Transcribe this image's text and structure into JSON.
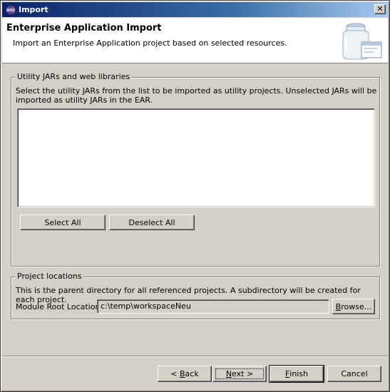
{
  "window": {
    "title": "Import"
  },
  "header": {
    "title": "Enterprise Application Import",
    "description": "Import an Enterprise Application project based on selected resources."
  },
  "utility_group": {
    "legend": "Utility JARs and web libraries",
    "description": "Select the utility JARs from the list to be imported as utility projects. Unselected JARs will be imported as utility JARs in the EAR.",
    "select_all_label": "Select All",
    "deselect_all_label": "Deselect All"
  },
  "project_locations": {
    "legend": "Project locations",
    "description": "This is the parent directory for all referenced projects. A subdirectory will be created for each project.",
    "module_root_label": "Module Root Location:",
    "module_root_value": "c:\\temp\\workspaceNeu",
    "browse_label": "Browse..."
  },
  "footer": {
    "back_prefix": "< ",
    "back_mnemonic": "B",
    "back_rest": "ack",
    "next_mnemonic": "N",
    "next_rest": "ext >",
    "finish_mnemonic": "F",
    "finish_rest": "inish",
    "cancel_label": "Cancel"
  }
}
